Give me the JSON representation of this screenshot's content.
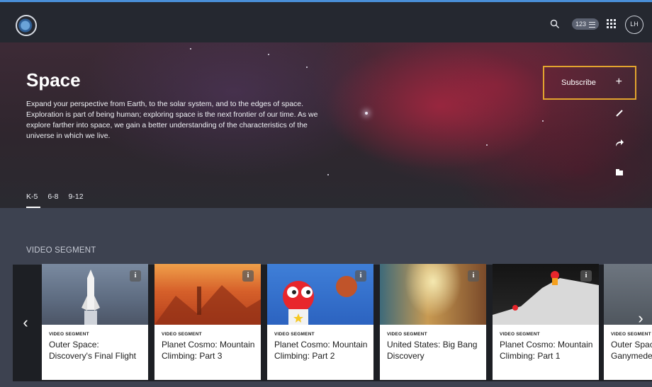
{
  "header": {
    "logo_name": "discovery-education-logo",
    "grade_badge": "123",
    "avatar_initials": "LH",
    "icons": [
      "search-icon",
      "filter-lines-icon",
      "apps-grid-icon"
    ]
  },
  "hero": {
    "title": "Space",
    "description": "Expand your perspective from Earth, to the solar system, and to the edges of space. Exploration is part of being human; exploring space is the next frontier of our time. As we explore farther into space, we gain a better understanding of the characteristics of the universe in which we live.",
    "subscribe_label": "Subscribe",
    "subscribe_accent": "#e3a42e",
    "side_actions": [
      "edit-icon",
      "share-icon",
      "add-to-folder-icon"
    ],
    "grade_tabs": [
      "K-5",
      "6-8",
      "9-12"
    ],
    "active_grade_tab": "K-5"
  },
  "section": {
    "label": "VIDEO SEGMENT"
  },
  "cards": [
    {
      "kicker": "VIDEO SEGMENT",
      "title": "Outer Space: Discovery's Final Flight"
    },
    {
      "kicker": "VIDEO SEGMENT",
      "title": "Planet Cosmo: Mountain Climbing: Part 3"
    },
    {
      "kicker": "VIDEO SEGMENT",
      "title": "Planet Cosmo: Mountain Climbing: Part 2"
    },
    {
      "kicker": "VIDEO SEGMENT",
      "title": "United States: Big Bang Discovery"
    },
    {
      "kicker": "VIDEO SEGMENT",
      "title": "Planet Cosmo: Mountain Climbing: Part 1"
    },
    {
      "kicker": "VIDEO SEGMENT",
      "title": "Outer Space on Ganymede"
    }
  ],
  "carousel": {
    "prev_icon": "chevron-left-icon",
    "next_icon": "chevron-right-icon"
  }
}
